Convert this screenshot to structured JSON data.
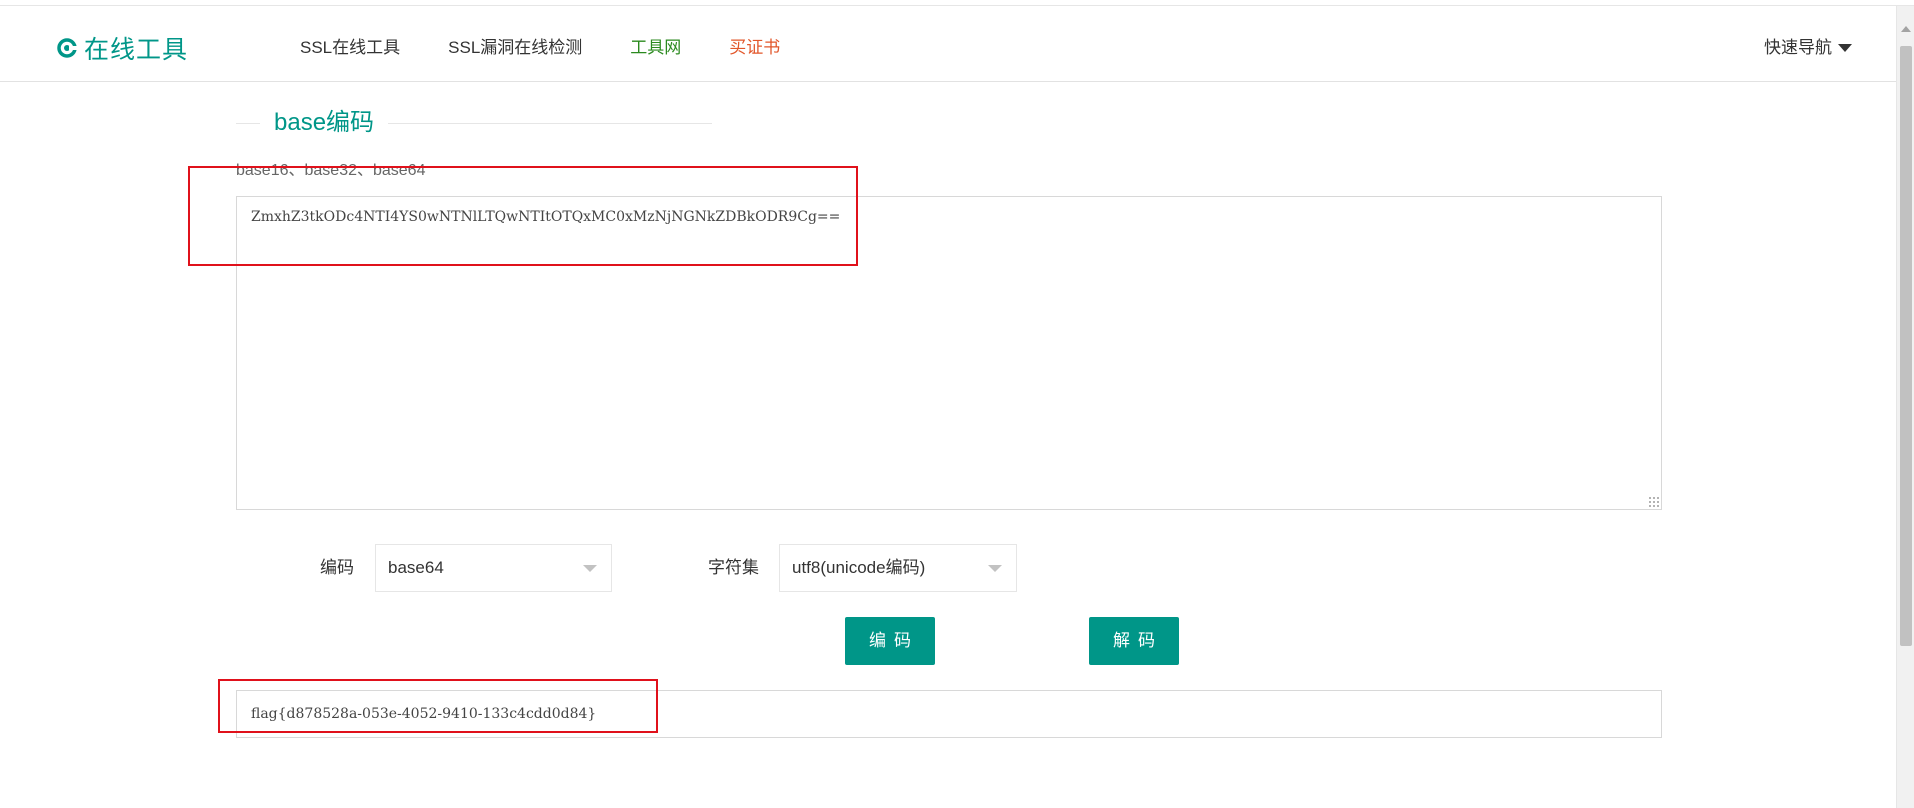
{
  "header": {
    "logo_text": "在线工具",
    "nav": [
      {
        "label": "SSL在线工具"
      },
      {
        "label": "SSL漏洞在线检测"
      },
      {
        "label": "工具网"
      },
      {
        "label": "买证书"
      }
    ],
    "quick_nav": "快速导航"
  },
  "section": {
    "title": "base编码",
    "subtitle": "base16、base32、base64"
  },
  "input": {
    "value": "ZmxhZ3tkODc4NTI4YS0wNTNlLTQwNTItOTQxMC0xMzNjNGNkZDBkODR9Cg=="
  },
  "controls": {
    "encoding_label": "编码",
    "encoding_value": "base64",
    "charset_label": "字符集",
    "charset_value": "utf8(unicode编码)",
    "encode_button": "编码",
    "decode_button": "解码"
  },
  "output": {
    "value": "flag{d878528a-053e-4052-9410-133c4cdd0d84}"
  },
  "colors": {
    "accent": "#009688",
    "annotation": "#e0111b",
    "nav_green": "#2b8a1f",
    "nav_orange": "#e2572b"
  }
}
